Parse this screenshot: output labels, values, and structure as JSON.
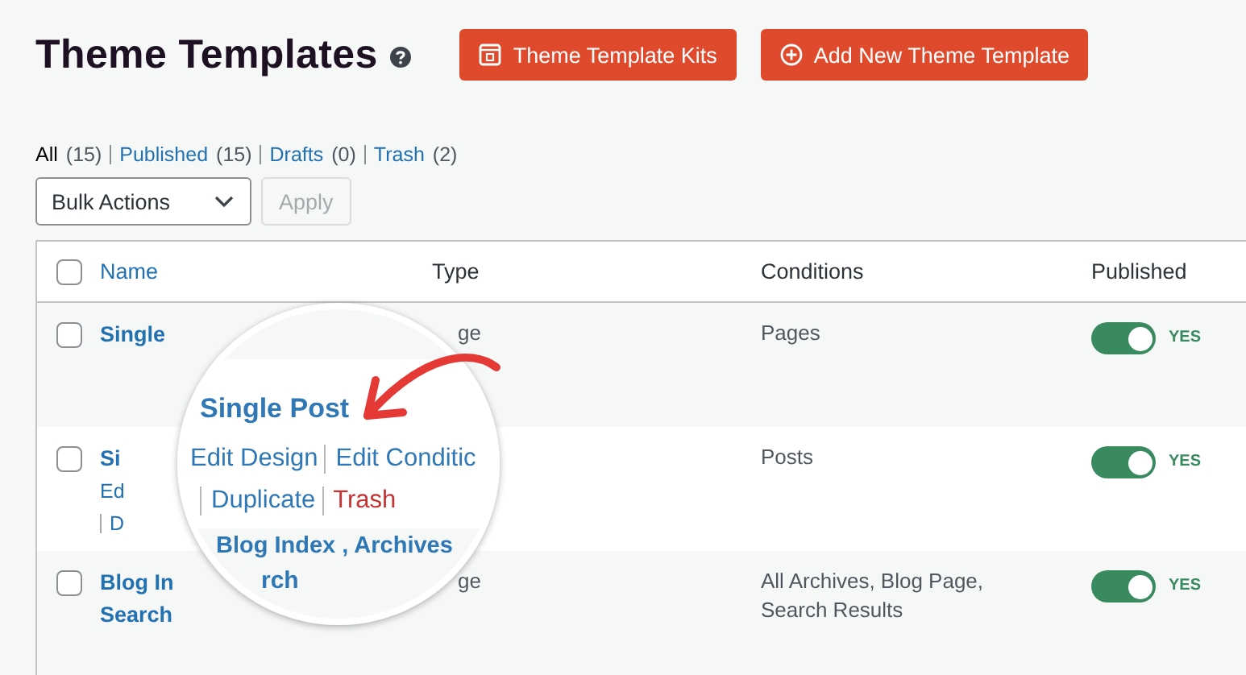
{
  "header": {
    "title": "Theme Templates",
    "buttons": [
      {
        "label": "Theme Template Kits",
        "kind": "kits"
      },
      {
        "label": "Add New Theme Template",
        "kind": "add"
      }
    ]
  },
  "filters": [
    {
      "label": "All",
      "count": "(15)",
      "selected": true
    },
    {
      "label": "Published",
      "count": "(15)",
      "selected": false
    },
    {
      "label": "Drafts",
      "count": "(0)",
      "selected": false
    },
    {
      "label": "Trash",
      "count": "(2)",
      "selected": false
    }
  ],
  "bulk": {
    "select": "Bulk Actions",
    "apply": "Apply",
    "apply_disabled": true
  },
  "table": {
    "select_all_checked": false,
    "columns": [
      "Name",
      "Type",
      "Conditions",
      "Published"
    ],
    "rows": [
      {
        "checked": false,
        "name_lines": [
          "Single"
        ],
        "actions": [],
        "type": "ge",
        "conditions": "Pages",
        "published": true,
        "published_label": "YES"
      },
      {
        "checked": false,
        "name_lines": [
          "Si"
        ],
        "actions": [
          "Ed",
          "D"
        ],
        "type": "",
        "conditions": "Posts",
        "published": true,
        "published_label": "YES"
      },
      {
        "checked": false,
        "name_lines": [
          "Blog In",
          "Search"
        ],
        "actions": [],
        "type": "ge",
        "conditions": "All Archives, Blog Page, Search Results",
        "published": true,
        "published_label": "YES"
      }
    ]
  },
  "magnifier": {
    "title": "Single Post",
    "action_lines": [
      [
        {
          "label": "Edit Design",
          "kind": "link"
        },
        {
          "label": "Edit Conditic",
          "kind": "link"
        }
      ],
      [
        {
          "label": "Duplicate",
          "kind": "link"
        },
        {
          "label": "Trash",
          "kind": "danger"
        }
      ]
    ],
    "next_title": "Blog Index , Archives",
    "next_title_end": "rch"
  }
}
